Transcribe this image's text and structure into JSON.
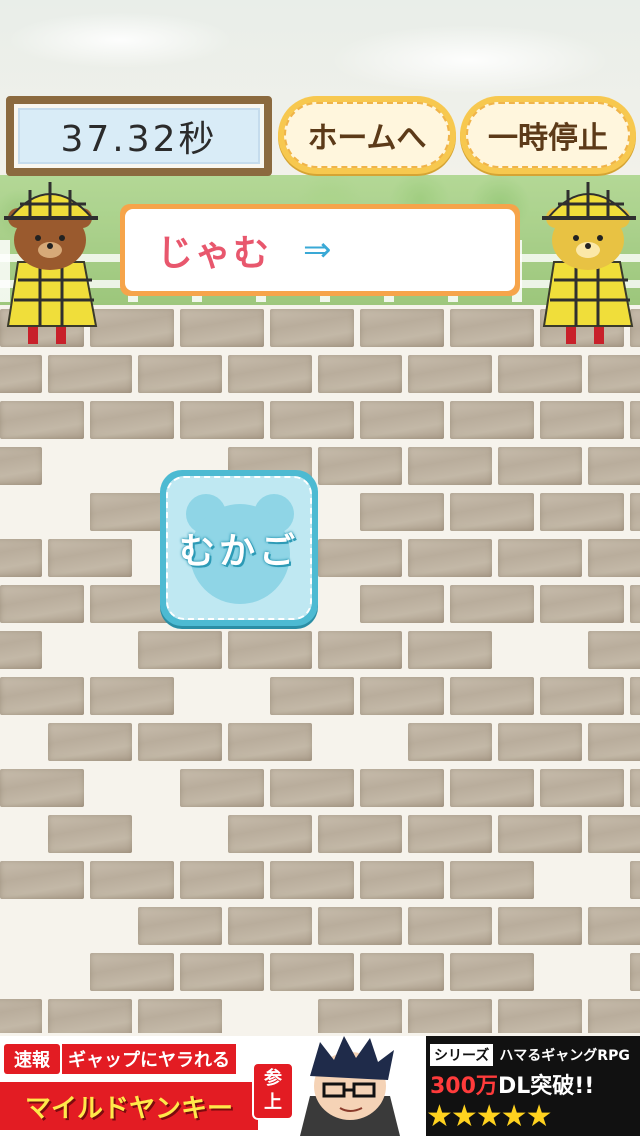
{
  "timer": {
    "value": "37.32秒"
  },
  "buttons": {
    "home": "ホームへ",
    "pause": "一時停止"
  },
  "word_card": {
    "text": "じゃむ",
    "arrow": "⇒"
  },
  "tile": {
    "text": "むかご"
  },
  "ad": {
    "tag": "速報",
    "headline": "ギャップにヤラれる",
    "title": "マイルドヤンキー",
    "badge_top": "参",
    "badge_bottom": "上",
    "series_box": "シリーズ",
    "series_text": "ハマるギャングRPG",
    "count_num": "300万",
    "count_text": "DL突破!!",
    "stars": "★★★★★"
  },
  "colors": {
    "accent_orange": "#f6a44a",
    "button_yellow": "#f7c84f",
    "tile_blue": "#4dbad2",
    "word_pink": "#e8576d",
    "arrow_blue": "#3aa9d6",
    "ad_red": "#e31c23"
  }
}
